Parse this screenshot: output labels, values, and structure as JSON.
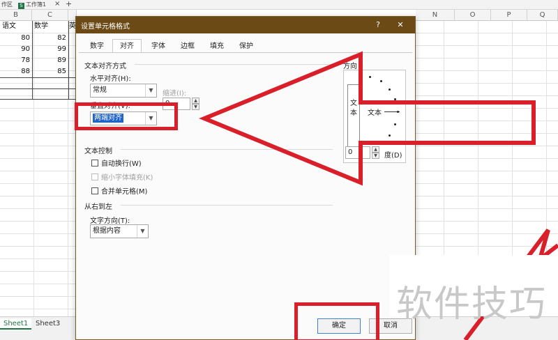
{
  "window_tabs": [
    {
      "label": "作区"
    },
    {
      "label": "工作簿1"
    },
    {
      "label": "+"
    }
  ],
  "columns": [
    "B",
    "C",
    "",
    "",
    "",
    "",
    "",
    "",
    "",
    "",
    "N",
    "O",
    "P",
    "Q"
  ],
  "table": {
    "headers": [
      "语文",
      "数学",
      "英"
    ],
    "rows": [
      [
        "80",
        "82"
      ],
      [
        "90",
        "99"
      ],
      [
        "78",
        "89"
      ],
      [
        "88",
        "85"
      ]
    ]
  },
  "sheets": [
    {
      "label": "Sheet1",
      "active": true
    },
    {
      "label": "Sheet3",
      "active": false
    }
  ],
  "dialog": {
    "title": "设置单元格格式",
    "help": "?",
    "close": "✕",
    "tabs": [
      "数字",
      "对齐",
      "字体",
      "边框",
      "填充",
      "保护"
    ],
    "active_tab": "对齐",
    "text_align_section": "文本对齐方式",
    "horizontal_label": "水平对齐(H):",
    "horizontal_value": "常规",
    "indent_label": "缩进(I):",
    "indent_value": "0",
    "vertical_label": "垂直对齐(V):",
    "vertical_value": "两端对齐",
    "text_control_section": "文本控制",
    "wrap_text": "自动换行(W)",
    "shrink_to_fit": "缩小字体填充(K)",
    "merge_cells": "合并单元格(M)",
    "rtl_section": "从右到左",
    "text_direction_label": "文字方向(T):",
    "text_direction_value": "根据内容",
    "orientation_section": "方向",
    "orientation_vertical_text": "文本",
    "orientation_dial_text": "文本",
    "degree_value": "0",
    "degree_label": "度(D)",
    "ok": "确定",
    "cancel": "取消"
  },
  "watermark": "软件技巧",
  "colors": {
    "titlebar": "#6b4a16",
    "highlight_annotation": "#d9202a",
    "selection": "#1f64c8",
    "sheet_active": "#217346"
  }
}
